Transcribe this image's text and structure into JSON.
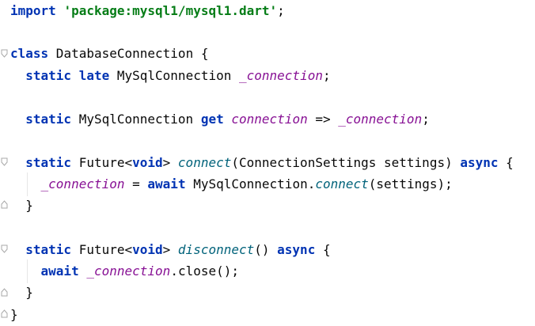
{
  "lines": [
    {
      "parts": [
        {
          "t": "import",
          "c": "kw"
        },
        {
          "t": " ",
          "c": "plain"
        },
        {
          "t": "'package:mysql1/mysql1.dart'",
          "c": "str"
        },
        {
          "t": ";",
          "c": "plain"
        }
      ]
    },
    {
      "parts": []
    },
    {
      "parts": [
        {
          "t": "class",
          "c": "kw"
        },
        {
          "t": " DatabaseConnection {",
          "c": "plain"
        }
      ]
    },
    {
      "parts": [
        {
          "t": "  ",
          "c": "plain"
        },
        {
          "t": "static",
          "c": "kw"
        },
        {
          "t": " ",
          "c": "plain"
        },
        {
          "t": "late",
          "c": "kw"
        },
        {
          "t": " MySqlConnection ",
          "c": "plain"
        },
        {
          "t": "_connection",
          "c": "ital"
        },
        {
          "t": ";",
          "c": "plain"
        }
      ]
    },
    {
      "parts": []
    },
    {
      "parts": [
        {
          "t": "  ",
          "c": "plain"
        },
        {
          "t": "static",
          "c": "kw"
        },
        {
          "t": " MySqlConnection ",
          "c": "plain"
        },
        {
          "t": "get",
          "c": "kw"
        },
        {
          "t": " ",
          "c": "plain"
        },
        {
          "t": "connection",
          "c": "ital"
        },
        {
          "t": " => ",
          "c": "plain"
        },
        {
          "t": "_connection",
          "c": "ital"
        },
        {
          "t": ";",
          "c": "plain"
        }
      ]
    },
    {
      "parts": []
    },
    {
      "parts": [
        {
          "t": "  ",
          "c": "plain"
        },
        {
          "t": "static",
          "c": "kw"
        },
        {
          "t": " Future<",
          "c": "plain"
        },
        {
          "t": "void",
          "c": "kw"
        },
        {
          "t": "> ",
          "c": "plain"
        },
        {
          "t": "connect",
          "c": "fn"
        },
        {
          "t": "(ConnectionSettings settings) ",
          "c": "plain"
        },
        {
          "t": "async",
          "c": "kw"
        },
        {
          "t": " {",
          "c": "plain"
        }
      ]
    },
    {
      "parts": [
        {
          "t": "    ",
          "c": "plain"
        },
        {
          "t": "_connection",
          "c": "ital"
        },
        {
          "t": " = ",
          "c": "plain"
        },
        {
          "t": "await",
          "c": "kw"
        },
        {
          "t": " MySqlConnection.",
          "c": "plain"
        },
        {
          "t": "connect",
          "c": "fn"
        },
        {
          "t": "(settings);",
          "c": "plain"
        }
      ]
    },
    {
      "parts": [
        {
          "t": "  }",
          "c": "plain"
        }
      ]
    },
    {
      "parts": []
    },
    {
      "parts": [
        {
          "t": "  ",
          "c": "plain"
        },
        {
          "t": "static",
          "c": "kw"
        },
        {
          "t": " Future<",
          "c": "plain"
        },
        {
          "t": "void",
          "c": "kw"
        },
        {
          "t": "> ",
          "c": "plain"
        },
        {
          "t": "disconnect",
          "c": "fn"
        },
        {
          "t": "() ",
          "c": "plain"
        },
        {
          "t": "async",
          "c": "kw"
        },
        {
          "t": " {",
          "c": "plain"
        }
      ]
    },
    {
      "parts": [
        {
          "t": "    ",
          "c": "plain"
        },
        {
          "t": "await",
          "c": "kw"
        },
        {
          "t": " ",
          "c": "plain"
        },
        {
          "t": "_connection",
          "c": "ital"
        },
        {
          "t": ".close();",
          "c": "plain"
        }
      ]
    },
    {
      "parts": [
        {
          "t": "  }",
          "c": "plain"
        }
      ]
    },
    {
      "parts": [
        {
          "t": "}",
          "c": "plain"
        }
      ]
    }
  ],
  "colors": {
    "keyword": "#0033b3",
    "string": "#067d17",
    "field": "#871094",
    "method": "#00627a",
    "text": "#080808",
    "background": "#ffffff"
  }
}
